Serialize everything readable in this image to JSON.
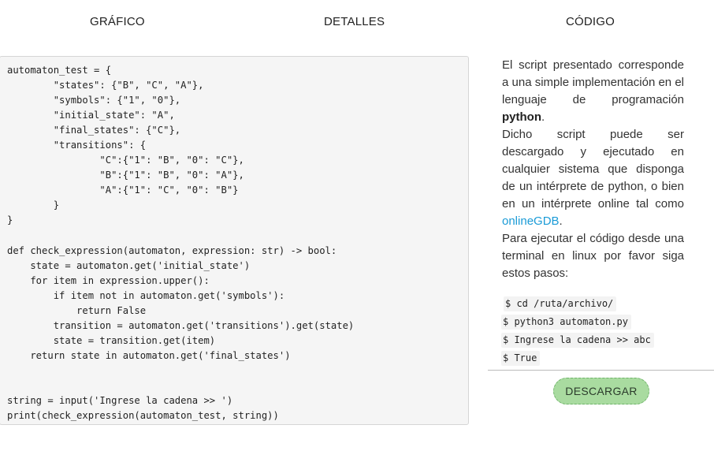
{
  "tabs": [
    {
      "label": "GRÁFICO"
    },
    {
      "label": "DETALLES"
    },
    {
      "label": "CÓDIGO"
    }
  ],
  "code": {
    "text": "automaton_test = {\n        \"states\": {\"B\", \"C\", \"A\"},\n        \"symbols\": {\"1\", \"0\"},\n        \"initial_state\": \"A\",\n        \"final_states\": {\"C\"},\n        \"transitions\": {\n                \"C\":{\"1\": \"B\", \"0\": \"C\"},\n                \"B\":{\"1\": \"B\", \"0\": \"A\"},\n                \"A\":{\"1\": \"C\", \"0\": \"B\"}\n        }\n}\n\ndef check_expression(automaton, expression: str) -> bool:\n    state = automaton.get('initial_state')\n    for item in expression.upper():\n        if item not in automaton.get('symbols'):\n            return False\n        transition = automaton.get('transitions').get(state)\n        state = transition.get(item)\n    return state in automaton.get('final_states')\n\n\nstring = input('Ingrese la cadena >> ')\nprint(check_expression(automaton_test, string))"
  },
  "description": {
    "p1_before": "El script presentado corresponde a una simple implementación en el lenguaje de programación ",
    "p1_bold": "python",
    "p1_after": ".",
    "p2_before": "Dicho script puede ser descargado y ejecutado en cualquier sistema que disponga de un intérprete de python, o bien en un intérprete online tal como ",
    "p2_link": "onlineGDB",
    "p2_after": ".",
    "p3": "Para ejecutar el código desde una terminal en linux por favor siga estos pasos:"
  },
  "commands": [
    "$ cd /ruta/archivo/",
    "$ python3 automaton.py",
    "$ Ingrese la cadena >> abc",
    "$ True"
  ],
  "download_button": {
    "label": "DESCARGAR"
  },
  "colors": {
    "link": "#1a9bd7",
    "button_bg": "#a9dba0",
    "code_bg": "#f5f5f5"
  }
}
